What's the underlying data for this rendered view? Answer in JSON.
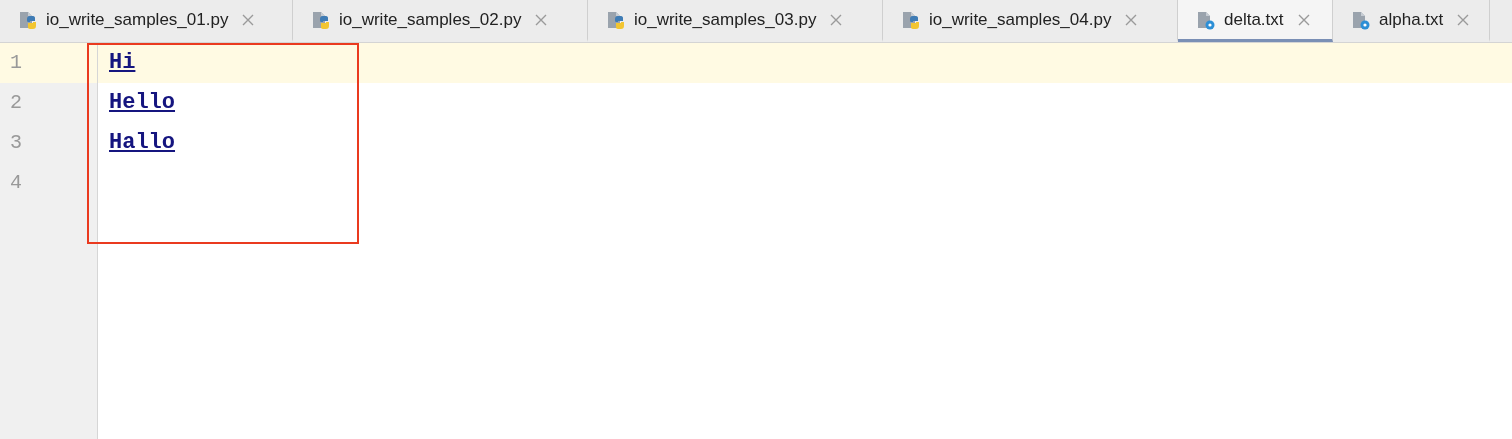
{
  "tabs": [
    {
      "label": "io_write_samples_01.py",
      "kind": "python",
      "selected": false
    },
    {
      "label": "io_write_samples_02.py",
      "kind": "python",
      "selected": false
    },
    {
      "label": "io_write_samples_03.py",
      "kind": "python",
      "selected": false
    },
    {
      "label": "io_write_samples_04.py",
      "kind": "python",
      "selected": false
    },
    {
      "label": "delta.txt",
      "kind": "text",
      "selected": true
    },
    {
      "label": "alpha.txt",
      "kind": "text",
      "selected": false
    }
  ],
  "editor": {
    "lines": [
      {
        "number": "1",
        "text": "Hi",
        "current": true
      },
      {
        "number": "2",
        "text": "Hello",
        "current": false
      },
      {
        "number": "3",
        "text": "Hallo",
        "current": false
      },
      {
        "number": "4",
        "current": false
      }
    ]
  }
}
